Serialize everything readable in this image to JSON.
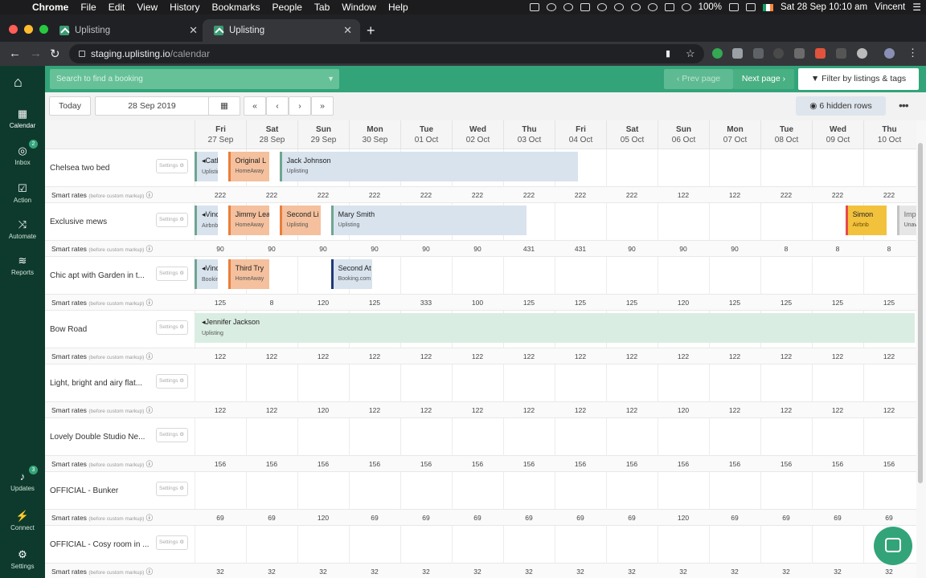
{
  "menubar": {
    "items": [
      "Chrome",
      "File",
      "Edit",
      "View",
      "History",
      "Bookmarks",
      "People",
      "Tab",
      "Window",
      "Help"
    ],
    "battery": "100%",
    "datetime": "Sat 28 Sep 10:10 am",
    "user": "Vincent"
  },
  "tabs": [
    {
      "title": "Uplisting",
      "active": false
    },
    {
      "title": "Uplisting",
      "active": true
    }
  ],
  "address": {
    "host": "staging.uplisting.io",
    "path": "/calendar"
  },
  "sidebar": {
    "items": [
      {
        "label": "Calendar",
        "icon": "calendar-icon",
        "glyph": "▦"
      },
      {
        "label": "Inbox",
        "icon": "chat-icon",
        "glyph": "◎",
        "badge": "2"
      },
      {
        "label": "Action",
        "icon": "checkbox-icon",
        "glyph": "☑"
      },
      {
        "label": "Automate",
        "icon": "shuffle-icon",
        "glyph": "⤨"
      },
      {
        "label": "Reports",
        "icon": "database-icon",
        "glyph": "≋"
      }
    ],
    "bottom": [
      {
        "label": "Updates",
        "icon": "bell-icon",
        "glyph": "♪",
        "badge": "3"
      },
      {
        "label": "Connect",
        "icon": "plug-icon",
        "glyph": "⚡"
      },
      {
        "label": "Settings",
        "icon": "gear-icon",
        "glyph": "⚙"
      }
    ]
  },
  "header": {
    "search_placeholder": "Search to find a booking",
    "prev_page": "‹ Prev page",
    "next_page": "Next page ›",
    "filter": "Filter by listings & tags"
  },
  "toolbar": {
    "today": "Today",
    "date": "28 Sep 2019",
    "nav": [
      "«",
      "‹",
      "›",
      "»"
    ],
    "hidden_rows": "6 hidden rows"
  },
  "dates": [
    {
      "dow": "Fri",
      "date": "27 Sep"
    },
    {
      "dow": "Sat",
      "date": "28 Sep"
    },
    {
      "dow": "Sun",
      "date": "29 Sep"
    },
    {
      "dow": "Mon",
      "date": "30 Sep"
    },
    {
      "dow": "Tue",
      "date": "01 Oct"
    },
    {
      "dow": "Wed",
      "date": "02 Oct"
    },
    {
      "dow": "Thu",
      "date": "03 Oct"
    },
    {
      "dow": "Fri",
      "date": "04 Oct"
    },
    {
      "dow": "Sat",
      "date": "05 Oct"
    },
    {
      "dow": "Sun",
      "date": "06 Oct"
    },
    {
      "dow": "Mon",
      "date": "07 Oct"
    },
    {
      "dow": "Tue",
      "date": "08 Oct"
    },
    {
      "dow": "Wed",
      "date": "09 Oct"
    },
    {
      "dow": "Thu",
      "date": "10 Oct"
    }
  ],
  "settings_label": "Settings ⚙",
  "rates_label": "Smart rates",
  "rates_note": "(before custom markup)",
  "listings": [
    {
      "name": "Chelsea two bed",
      "rates": [
        "222",
        "222",
        "222",
        "222",
        "222",
        "222",
        "222",
        "222",
        "222",
        "122",
        "122",
        "222",
        "222",
        "222"
      ],
      "bookings": [
        {
          "guest": "Cath",
          "source": "Uplisting",
          "type": "up",
          "start": 0,
          "nights": 0.45,
          "continues": true
        },
        {
          "guest": "Original L",
          "source": "HomeAway",
          "type": "ha",
          "start": 0.65,
          "nights": 0.8
        },
        {
          "guest": "Jack Johnson",
          "source": "Uplisting",
          "type": "up",
          "start": 1.65,
          "nights": 5.8
        }
      ]
    },
    {
      "name": "Exclusive mews",
      "rates": [
        "90",
        "90",
        "90",
        "90",
        "90",
        "90",
        "431",
        "431",
        "90",
        "90",
        "90",
        "8",
        "8",
        "8"
      ],
      "bookings": [
        {
          "guest": "Vince",
          "source": "Airbnb",
          "type": "up",
          "start": 0,
          "nights": 0.45,
          "continues": true
        },
        {
          "guest": "Jimmy Lea",
          "source": "HomeAway",
          "type": "ha",
          "start": 0.65,
          "nights": 0.8
        },
        {
          "guest": "Second Li",
          "source": "Uplisting",
          "type": "ha",
          "start": 1.65,
          "nights": 0.8
        },
        {
          "guest": "Mary Smith",
          "source": "Uplisting",
          "type": "up",
          "start": 2.65,
          "nights": 3.8
        },
        {
          "guest": "Simon",
          "source": "Airbnb",
          "type": "ab",
          "start": 12.65,
          "nights": 0.8
        },
        {
          "guest": "Imp",
          "source": "Unav",
          "type": "un",
          "start": 13.65,
          "nights": 0.6
        }
      ]
    },
    {
      "name": "Chic apt with Garden in t...",
      "rates": [
        "125",
        "8",
        "120",
        "125",
        "333",
        "100",
        "125",
        "125",
        "125",
        "120",
        "125",
        "125",
        "125",
        "125"
      ],
      "bookings": [
        {
          "guest": "Vince",
          "source": "Booking",
          "type": "up",
          "start": 0,
          "nights": 0.45,
          "continues": true
        },
        {
          "guest": "Third Try",
          "source": "HomeAway",
          "type": "ha",
          "start": 0.65,
          "nights": 0.8
        },
        {
          "guest": "Second At",
          "source": "Booking.com",
          "type": "bc",
          "start": 2.65,
          "nights": 0.8
        }
      ]
    },
    {
      "name": "Bow Road",
      "rates": [
        "122",
        "122",
        "122",
        "122",
        "122",
        "122",
        "122",
        "122",
        "122",
        "122",
        "122",
        "122",
        "122",
        "122"
      ],
      "bookings": [
        {
          "guest": "Jennifer Jackson",
          "source": "Uplisting",
          "type": "br",
          "start": 0,
          "nights": 14,
          "continues": true
        }
      ]
    },
    {
      "name": "Light, bright and airy flat...",
      "rates": [
        "122",
        "122",
        "120",
        "122",
        "122",
        "122",
        "122",
        "122",
        "122",
        "120",
        "122",
        "122",
        "122",
        "122"
      ],
      "bookings": []
    },
    {
      "name": "Lovely Double Studio Ne...",
      "rates": [
        "156",
        "156",
        "156",
        "156",
        "156",
        "156",
        "156",
        "156",
        "156",
        "156",
        "156",
        "156",
        "156",
        "156"
      ],
      "bookings": []
    },
    {
      "name": "OFFICIAL - Bunker",
      "rates": [
        "69",
        "69",
        "120",
        "69",
        "69",
        "69",
        "69",
        "69",
        "69",
        "120",
        "69",
        "69",
        "69",
        "69"
      ],
      "bookings": []
    },
    {
      "name": "OFFICIAL - Cosy room in ...",
      "rates": [
        "32",
        "32",
        "32",
        "32",
        "32",
        "32",
        "32",
        "32",
        "32",
        "32",
        "32",
        "32",
        "32",
        "32"
      ],
      "bookings": []
    }
  ]
}
